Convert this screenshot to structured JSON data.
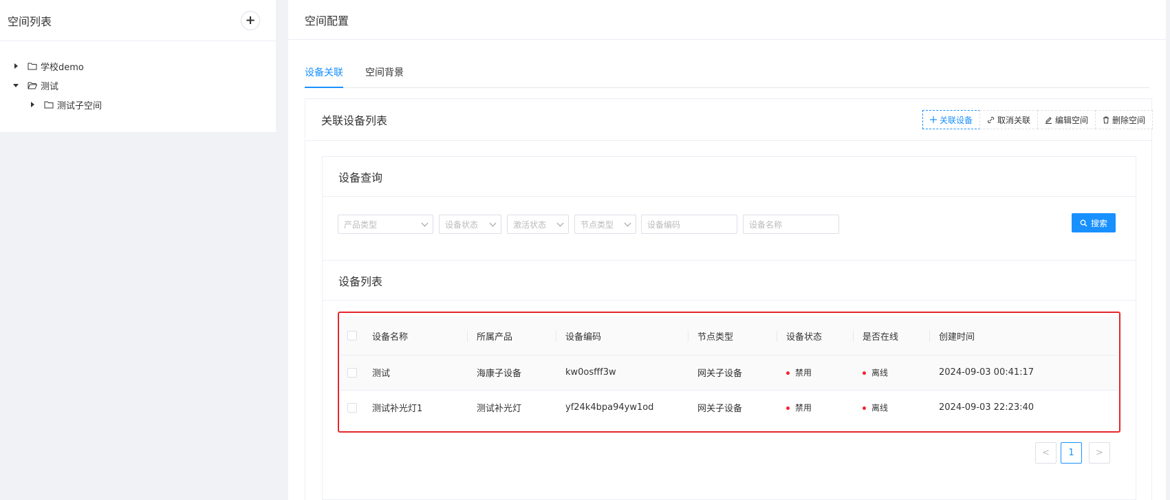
{
  "left": {
    "title": "空间列表",
    "add_label": "+",
    "tree": [
      {
        "label": "学校demo",
        "expanded": false,
        "level": 0
      },
      {
        "label": "测试",
        "expanded": true,
        "level": 0
      },
      {
        "label": "测试子空间",
        "expanded": false,
        "level": 1
      }
    ]
  },
  "right": {
    "title": "空间配置",
    "tabs": [
      {
        "label": "设备关联",
        "active": true
      },
      {
        "label": "空间背景",
        "active": false
      }
    ]
  },
  "card": {
    "title": "关联设备列表",
    "actions": [
      {
        "icon": "plus-icon",
        "label": "关联设备"
      },
      {
        "icon": "unlink-icon",
        "label": "取消关联"
      },
      {
        "icon": "edit-icon",
        "label": "编辑空间"
      },
      {
        "icon": "trash-icon",
        "label": "删除空间"
      }
    ]
  },
  "query": {
    "title": "设备查询",
    "product_type_placeholder": "产品类型",
    "device_status_placeholder": "设备状态",
    "activation_status_placeholder": "激活状态",
    "node_type_placeholder": "节点类型",
    "device_code_placeholder": "设备编码",
    "device_name_placeholder": "设备名称",
    "search_label": "搜索"
  },
  "device_list": {
    "title": "设备列表",
    "columns": [
      "设备名称",
      "所属产品",
      "设备编码",
      "节点类型",
      "设备状态",
      "是否在线",
      "创建时间"
    ],
    "rows": [
      {
        "name": "测试",
        "product": "海康子设备",
        "code": "kw0osfff3w",
        "node_type": "网关子设备",
        "status": "禁用",
        "online": "离线",
        "created": "2024-09-03 00:41:17"
      },
      {
        "name": "测试补光灯1",
        "product": "测试补光灯",
        "code": "yf24k4bpa94yw1od",
        "node_type": "网关子设备",
        "status": "禁用",
        "online": "离线",
        "created": "2024-09-03 22:23:40"
      }
    ]
  },
  "pagination": {
    "prev": "<",
    "current": "1",
    "next": ">"
  },
  "colors": {
    "accent": "#1890ff",
    "highlight": "#e5252a",
    "status_dot": "#f5222d"
  }
}
